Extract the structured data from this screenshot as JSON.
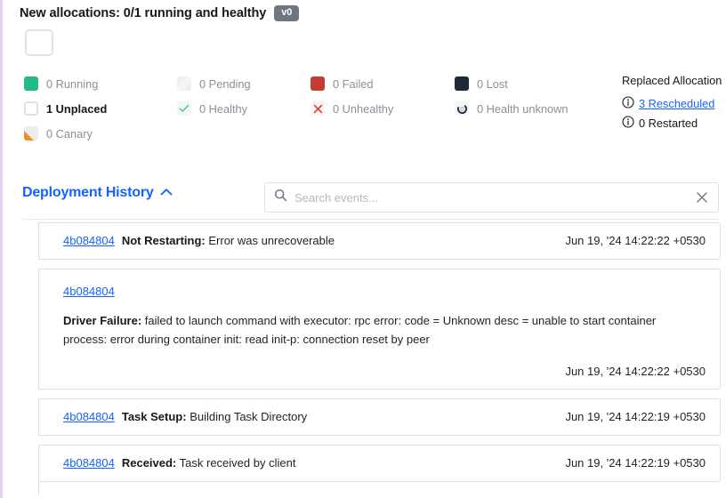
{
  "header": {
    "title": "New allocations: 0/1 running and healthy",
    "version_badge": "v0"
  },
  "legend": {
    "items": [
      {
        "label": "0 Running",
        "swatch": "running-swatch",
        "emphasis": false
      },
      {
        "label": "0 Pending",
        "swatch": "pending-swatch",
        "emphasis": false
      },
      {
        "label": "0 Failed",
        "swatch": "failed-swatch",
        "emphasis": false
      },
      {
        "label": "0 Lost",
        "swatch": "lost-swatch",
        "emphasis": false
      },
      {
        "label": "1 Unplaced",
        "swatch": "unplaced-swatch",
        "emphasis": true
      },
      {
        "label": "0 Healthy",
        "swatch": "healthy-check-icon",
        "emphasis": false
      },
      {
        "label": "0 Unhealthy",
        "swatch": "unhealthy-x-icon",
        "emphasis": false
      },
      {
        "label": "0 Health unknown",
        "swatch": "health-unknown-icon",
        "emphasis": false
      },
      {
        "label": "0 Canary",
        "swatch": "canary-swatch",
        "emphasis": false
      }
    ]
  },
  "replaced": {
    "title": "Replaced Allocation",
    "rescheduled": "3 Rescheduled",
    "restarted": "0 Restarted"
  },
  "deployment_history": {
    "title": "Deployment History",
    "collapse_icon": "chevron-up-icon",
    "search": {
      "placeholder": "Search events...",
      "value": "",
      "icon": "search-icon",
      "clear_icon": "close-icon"
    },
    "events": [
      {
        "alloc_id": "4b084804",
        "type": "Not Restarting:",
        "message": "Error was unrecoverable",
        "timestamp": "Jun 19, '24 14:22:22 +0530",
        "expanded": false
      },
      {
        "alloc_id": "4b084804",
        "type": "Driver Failure:",
        "message": "failed to launch command with executor: rpc error: code = Unknown desc = unable to start container process: error during container init: read init-p: connection reset by peer",
        "timestamp": "Jun 19, '24 14:22:22 +0530",
        "expanded": true
      },
      {
        "alloc_id": "4b084804",
        "type": "Task Setup:",
        "message": "Building Task Directory",
        "timestamp": "Jun 19, '24 14:22:19 +0530",
        "expanded": false
      },
      {
        "alloc_id": "4b084804",
        "type": "Received:",
        "message": "Task received by client",
        "timestamp": "Jun 19, '24 14:22:19 +0530",
        "expanded": false
      }
    ]
  },
  "colors": {
    "running": "#25ba81",
    "failed": "#c33d30",
    "lost": "#1d2a38",
    "canary": "#fa8c28",
    "link": "#1563ff",
    "badge": "#6f7682"
  }
}
